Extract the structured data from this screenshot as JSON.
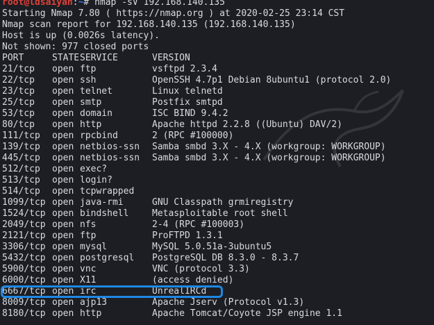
{
  "prompt": {
    "user": "root",
    "at": "@",
    "host": "ldsaiyan",
    "colon": ":",
    "path": "~",
    "hash": "# ",
    "command": "nmap -sV 192.168.140.135"
  },
  "output_header": [
    "Starting Nmap 7.80 ( https://nmap.org ) at 2020-02-25 23:14 CST",
    "Nmap scan report for 192.168.140.135 (192.168.140.135)",
    "Host is up (0.0026s latency).",
    "Not shown: 977 closed ports"
  ],
  "columns": {
    "port": "PORT",
    "state": "STATE",
    "service": "SERVICE",
    "version": "VERSION"
  },
  "rows": [
    {
      "port": "21/tcp",
      "state": "open",
      "service": "ftp",
      "version": "vsftpd 2.3.4"
    },
    {
      "port": "22/tcp",
      "state": "open",
      "service": "ssh",
      "version": "OpenSSH 4.7p1 Debian 8ubuntu1 (protocol 2.0)"
    },
    {
      "port": "23/tcp",
      "state": "open",
      "service": "telnet",
      "version": "Linux telnetd"
    },
    {
      "port": "25/tcp",
      "state": "open",
      "service": "smtp",
      "version": "Postfix smtpd"
    },
    {
      "port": "53/tcp",
      "state": "open",
      "service": "domain",
      "version": "ISC BIND 9.4.2"
    },
    {
      "port": "80/tcp",
      "state": "open",
      "service": "http",
      "version": "Apache httpd 2.2.8 ((Ubuntu) DAV/2)"
    },
    {
      "port": "111/tcp",
      "state": "open",
      "service": "rpcbind",
      "version": "2 (RPC #100000)"
    },
    {
      "port": "139/tcp",
      "state": "open",
      "service": "netbios-ssn",
      "version": "Samba smbd 3.X - 4.X (workgroup: WORKGROUP)"
    },
    {
      "port": "445/tcp",
      "state": "open",
      "service": "netbios-ssn",
      "version": "Samba smbd 3.X - 4.X (workgroup: WORKGROUP)"
    },
    {
      "port": "512/tcp",
      "state": "open",
      "service": "exec?",
      "version": ""
    },
    {
      "port": "513/tcp",
      "state": "open",
      "service": "login?",
      "version": ""
    },
    {
      "port": "514/tcp",
      "state": "open",
      "service": "tcpwrapped",
      "version": ""
    },
    {
      "port": "1099/tcp",
      "state": "open",
      "service": "java-rmi",
      "version": "GNU Classpath grmiregistry"
    },
    {
      "port": "1524/tcp",
      "state": "open",
      "service": "bindshell",
      "version": "Metasploitable root shell"
    },
    {
      "port": "2049/tcp",
      "state": "open",
      "service": "nfs",
      "version": "2-4 (RPC #100003)"
    },
    {
      "port": "2121/tcp",
      "state": "open",
      "service": "ftp",
      "version": "ProFTPD 1.3.1"
    },
    {
      "port": "3306/tcp",
      "state": "open",
      "service": "mysql",
      "version": "MySQL 5.0.51a-3ubuntu5"
    },
    {
      "port": "5432/tcp",
      "state": "open",
      "service": "postgresql",
      "version": "PostgreSQL DB 8.3.0 - 8.3.7"
    },
    {
      "port": "5900/tcp",
      "state": "open",
      "service": "vnc",
      "version": "VNC (protocol 3.3)"
    },
    {
      "port": "6000/tcp",
      "state": "open",
      "service": "X11",
      "version": "(access denied)"
    },
    {
      "port": "6667/tcp",
      "state": "open",
      "service": "irc",
      "version": "UnrealIRCd"
    },
    {
      "port": "8009/tcp",
      "state": "open",
      "service": "ajp13",
      "version": "Apache Jserv (Protocol v1.3)"
    },
    {
      "port": "8180/tcp",
      "state": "open",
      "service": "http",
      "version": "Apache Tomcat/Coyote JSP engine 1.1"
    }
  ],
  "highlighted_row_index": 20,
  "colors": {
    "background": "#1c1e23",
    "text": "#d8dbe1",
    "prompt_user": "#e0413a",
    "prompt_path": "#3b78e7",
    "highlight_border": "#1e88e5"
  },
  "icons": {
    "watermark": "kali-dragon-icon"
  }
}
